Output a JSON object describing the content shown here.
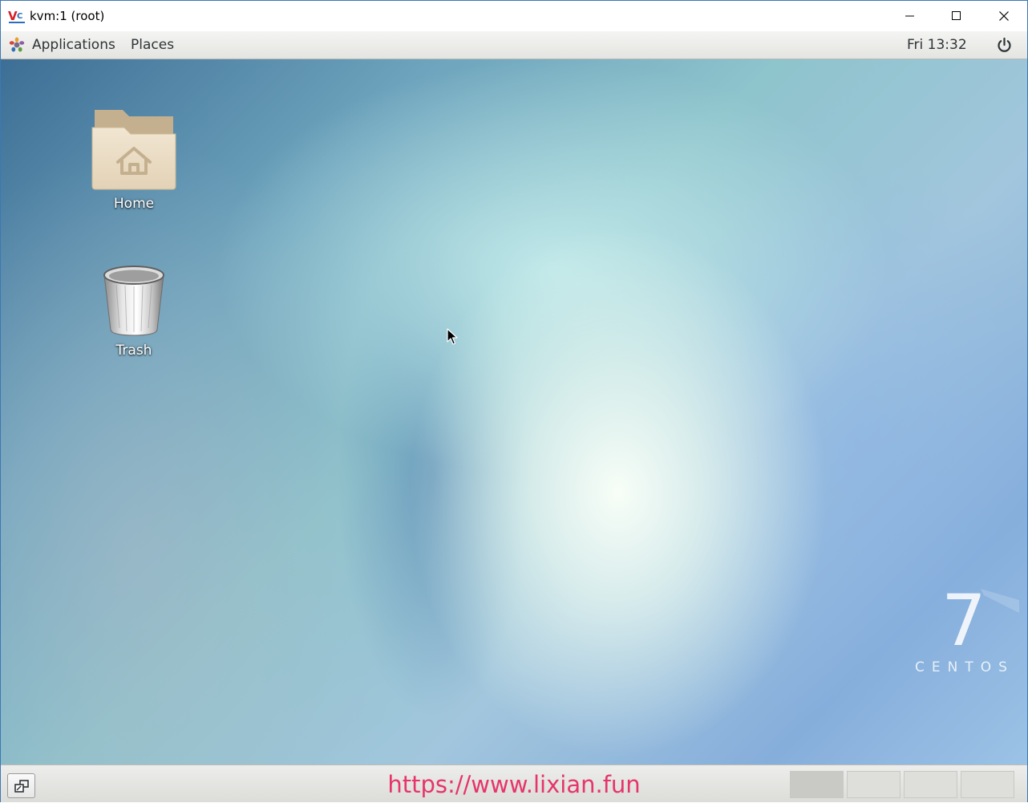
{
  "window": {
    "title": "kvm:1 (root)",
    "app_icon": "vnc-viewer-logo"
  },
  "panel": {
    "applications_label": "Applications",
    "places_label": "Places",
    "clock": "Fri 13:32",
    "power_icon": "power-icon"
  },
  "desktop": {
    "icons": [
      {
        "label": "Home",
        "icon": "home-folder-icon"
      },
      {
        "label": "Trash",
        "icon": "trash-icon"
      }
    ],
    "branding": {
      "number": "7",
      "word": "CENTOS"
    }
  },
  "bottombar": {
    "watermark": "https://www.lixian.fun",
    "workspaces": [
      "workspace-1",
      "workspace-2",
      "workspace-3",
      "workspace-4"
    ],
    "active_workspace": 1
  },
  "colors": {
    "watermark": "#e5356a",
    "window_border": "#3c78b4"
  }
}
